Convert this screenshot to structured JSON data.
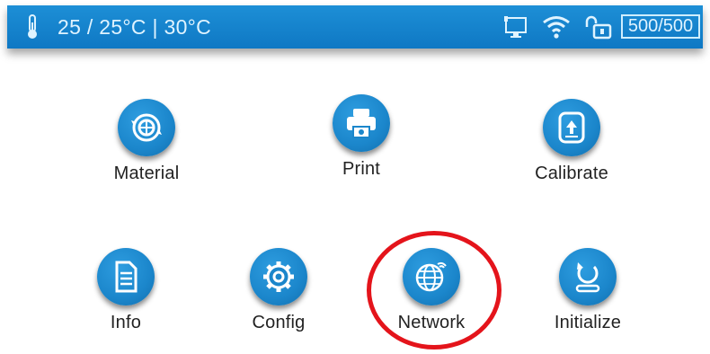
{
  "status_bar": {
    "temperature_text": "25 / 25°C | 30°C",
    "counter_text": "500/500",
    "icons": [
      "thermometer-icon",
      "usb-icon",
      "wifi-icon",
      "lock-icon"
    ]
  },
  "menu": {
    "material": {
      "label": "Material",
      "icon": "material-icon"
    },
    "print": {
      "label": "Print",
      "icon": "printer-icon"
    },
    "calibrate": {
      "label": "Calibrate",
      "icon": "calibrate-icon"
    },
    "info": {
      "label": "Info",
      "icon": "document-icon"
    },
    "config": {
      "label": "Config",
      "icon": "gear-icon"
    },
    "network": {
      "label": "Network",
      "icon": "globe-icon"
    },
    "initialize": {
      "label": "Initialize",
      "icon": "reset-icon"
    }
  },
  "annotation": {
    "highlighted_item": "Network",
    "ring_color": "#e4141b"
  },
  "colors": {
    "accent": "#1486cc",
    "statusbar": "#1480ca",
    "label": "#222222"
  }
}
